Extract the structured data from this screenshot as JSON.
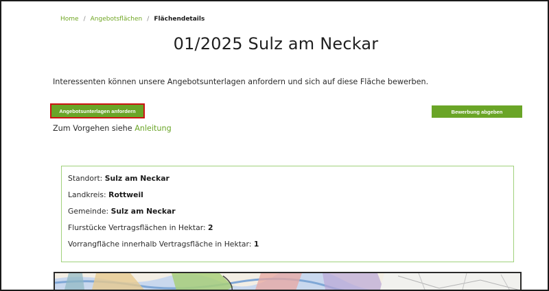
{
  "breadcrumb": {
    "home": "Home",
    "offers": "Angebotsflächen",
    "current": "Flächendetails",
    "separator": "/"
  },
  "title": "01/2025 Sulz am Neckar",
  "intro": "Interessenten können unsere Angebotsunterlagen anfordern und sich auf diese Fläche bewerben.",
  "actions": {
    "request_label": "Angebotsunterlagen anfordern",
    "apply_label": "Bewerbung abgeben"
  },
  "procedure": {
    "text": "Zum Vorgehen siehe ",
    "link": "Anleitung"
  },
  "details": [
    {
      "label": "Standort: ",
      "value": "Sulz am Neckar"
    },
    {
      "label": "Landkreis: ",
      "value": "Rottweil"
    },
    {
      "label": "Gemeinde: ",
      "value": "Sulz am Neckar"
    },
    {
      "label": "Flurstücke Vertragsflächen in Hektar: ",
      "value": "2"
    },
    {
      "label": "Vorrangfläche innerhalb Vertragsfläche in Hektar: ",
      "value": "1"
    }
  ],
  "colors": {
    "accent": "#6aa527",
    "highlight": "#cc1111",
    "box_border": "#9fd17a"
  }
}
